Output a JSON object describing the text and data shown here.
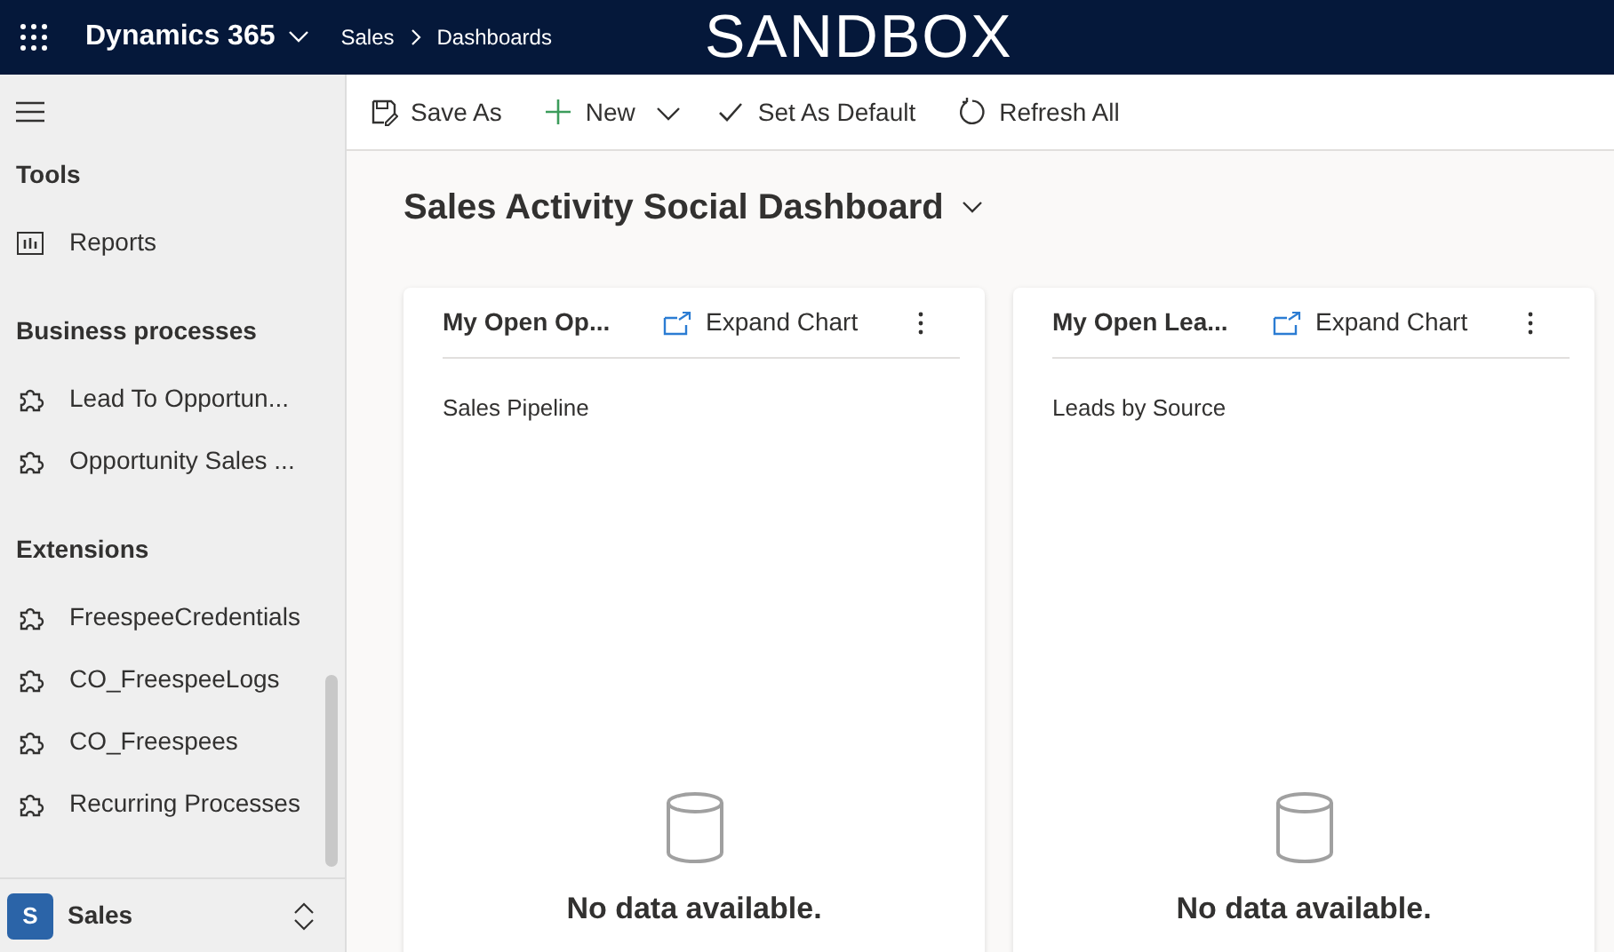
{
  "header": {
    "app_name": "Dynamics 365",
    "breadcrumb": [
      "Sales",
      "Dashboards"
    ],
    "banner": "SANDBOX"
  },
  "sidebar": {
    "sections": [
      {
        "title": "Tools",
        "items": [
          {
            "label": "Reports",
            "kind": "report"
          }
        ]
      },
      {
        "title": "Business processes",
        "items": [
          {
            "label": "Lead To Opportun...",
            "kind": "process"
          },
          {
            "label": "Opportunity Sales ...",
            "kind": "process"
          }
        ]
      },
      {
        "title": "Extensions",
        "items": [
          {
            "label": "FreespeeCredentials",
            "kind": "process"
          },
          {
            "label": "CO_FreespeeLogs",
            "kind": "process"
          },
          {
            "label": "CO_Freespees",
            "kind": "process"
          },
          {
            "label": "Recurring Processes",
            "kind": "process"
          }
        ]
      }
    ],
    "area": {
      "initial": "S",
      "label": "Sales"
    }
  },
  "toolbar": [
    {
      "label": "Save As",
      "kind": "save"
    },
    {
      "label": "New",
      "kind": "new",
      "dropdown": true
    },
    {
      "label": "Set As Default",
      "kind": "default"
    },
    {
      "label": "Refresh All",
      "kind": "refresh"
    }
  ],
  "dashboard": {
    "title": "Sales Activity Social Dashboard",
    "cards": [
      {
        "title": "My Open Op...",
        "action": "Expand Chart",
        "chart_name": "Sales Pipeline",
        "empty_message": "No data available."
      },
      {
        "title": "My Open Lea...",
        "action": "Expand Chart",
        "chart_name": "Leads by Source",
        "empty_message": "No data available."
      }
    ]
  }
}
